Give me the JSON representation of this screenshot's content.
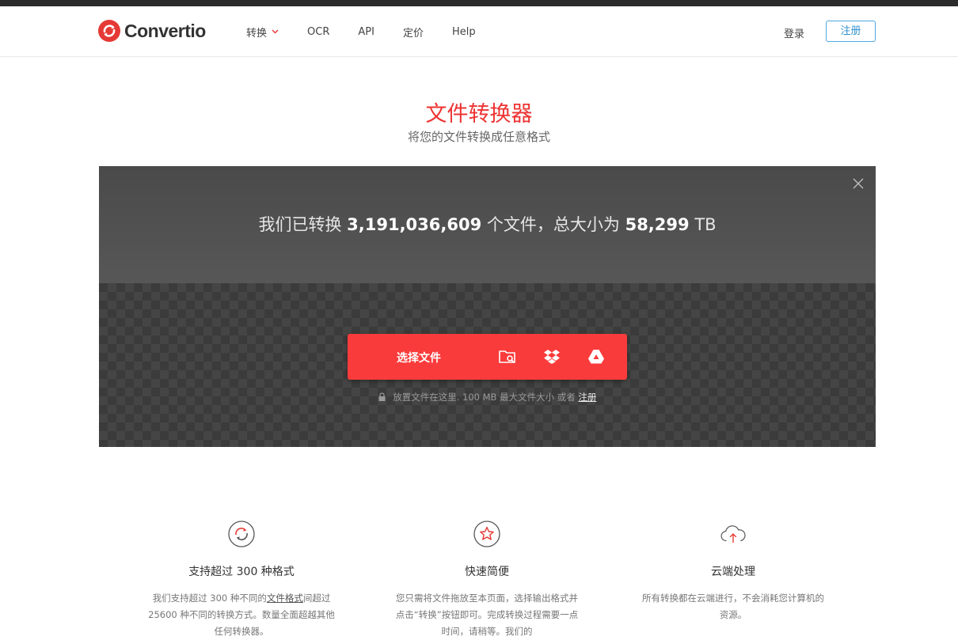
{
  "brand": {
    "name": "Convertio"
  },
  "nav": {
    "items": [
      "转换",
      "OCR",
      "API",
      "定价",
      "Help"
    ]
  },
  "auth": {
    "login": "登录",
    "signup": "注册"
  },
  "hero": {
    "title": "文件转换器",
    "subtitle": "将您的文件转换成任意格式"
  },
  "stats": {
    "prefix": "我们已转换",
    "files": "3,191,036,609",
    "middle": "个文件，总大小为",
    "size": "58,299",
    "unit": "TB"
  },
  "upload": {
    "button_label": "选择文件",
    "sources": [
      "folder-search-icon",
      "dropbox-icon",
      "google-drive-icon"
    ],
    "hint_prefix": "放置文件在这里. 100 MB 最大文件大小 或者",
    "hint_link": "注册"
  },
  "features": [
    {
      "icon": "sync-icon",
      "title": "支持超过 300 种格式",
      "text_before": "我们支持超过 300 种不同的",
      "text_link": "文件格式",
      "text_after": "间超过 25600 种不同的转换方式。数量全面超越其他任何转换器。"
    },
    {
      "icon": "star-icon",
      "title": "快速简便",
      "text": "您只需将文件拖放至本页面，选择输出格式并点击“转换”按钮即可。完成转换过程需要一点时间，请稍等。我们的"
    },
    {
      "icon": "cloud-upload-icon",
      "title": "云端处理",
      "text": "所有转换都在云端进行，不会消耗您计算机的资源。"
    }
  ],
  "colors": {
    "accent": "#fa3b3b",
    "brand_red": "#e53935",
    "signup_blue": "#2f8fd1"
  }
}
